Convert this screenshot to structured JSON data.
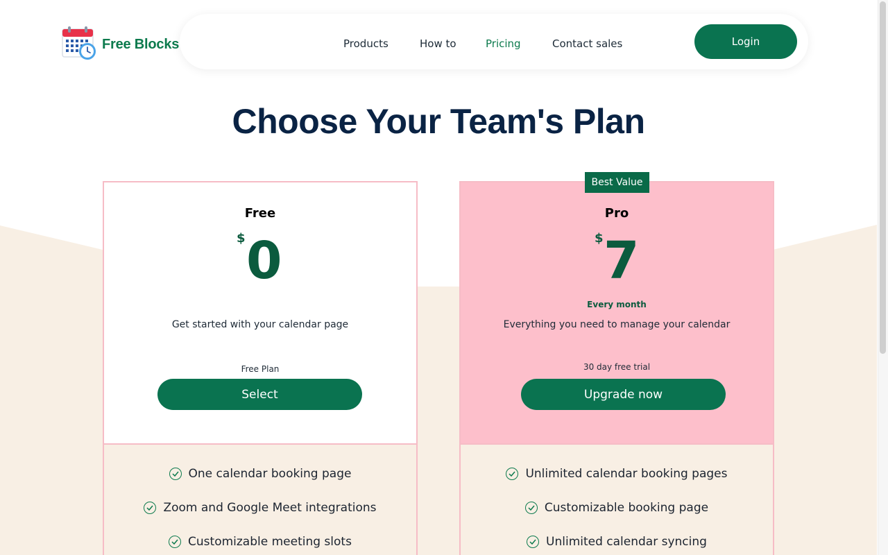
{
  "header": {
    "logo_text": "Free Blocks",
    "nav": [
      "Products",
      "How to",
      "Pricing",
      "Contact sales"
    ],
    "active_nav": "Pricing",
    "login_label": "Login"
  },
  "title": "Choose Your Team's Plan",
  "plans": [
    {
      "name": "Free",
      "currency": "$",
      "price": "0",
      "period": "",
      "description": "Get started with your calendar page",
      "note": "Free Plan",
      "cta": "Select",
      "features": [
        "One calendar booking page",
        "Zoom and Google Meet integrations",
        "Customizable meeting slots"
      ]
    },
    {
      "name": "Pro",
      "badge": "Best Value",
      "currency": "$",
      "price": "7",
      "period": "Every month",
      "description": "Everything you need to manage your calendar",
      "note": "30 day free trial",
      "cta": "Upgrade now",
      "features": [
        "Unlimited calendar booking pages",
        "Customizable booking page",
        "Unlimited calendar syncing"
      ]
    }
  ],
  "colors": {
    "brand_green": "#0a7350",
    "price_green": "#0b5b3e",
    "pro_card_pink": "#fdbfcb",
    "card_border": "#f6bcc6",
    "beige": "#f8efe4",
    "title_navy": "#0a2344"
  },
  "icons": {
    "logo": "calendar-clock-icon",
    "feature_check": "check-circle-icon"
  }
}
